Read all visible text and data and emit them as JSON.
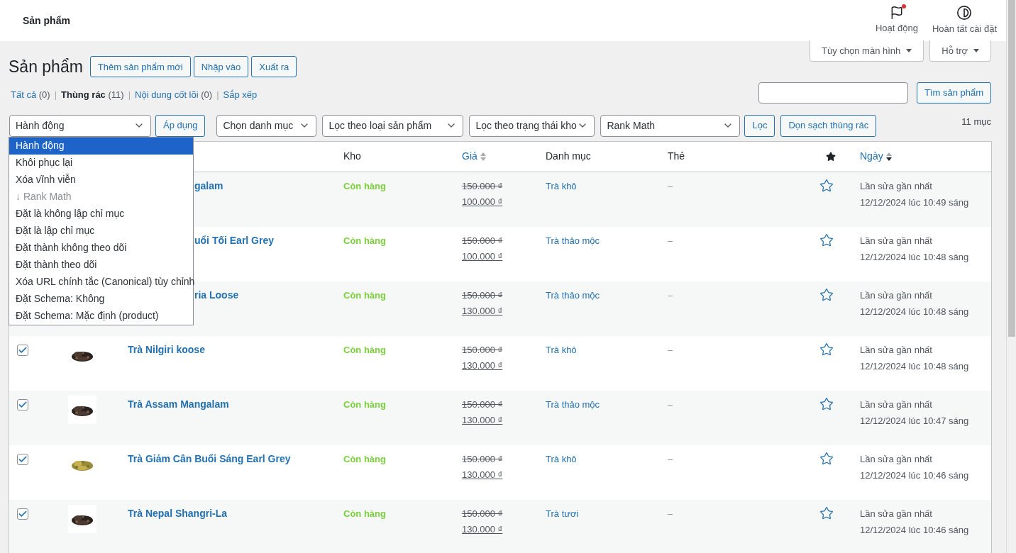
{
  "topbar": {
    "title": "Sản phẩm",
    "actions": [
      {
        "kind": "flag",
        "label": "Hoạt động",
        "badge": true
      },
      {
        "kind": "contrast",
        "label": "Hoàn tất cài đặt",
        "badge": false
      }
    ]
  },
  "screen_tabs": [
    "Tùy chọn màn hình",
    "Hỗ trợ"
  ],
  "heading": "Sản phẩm",
  "heading_buttons": [
    "Thêm sản phẩm mới",
    "Nhập vào",
    "Xuất ra"
  ],
  "views": [
    {
      "label": "Tất cả",
      "count": "(0)",
      "selected": false
    },
    {
      "separator": "|",
      "label": "Thùng rác",
      "count": "(11)",
      "selected": true
    },
    {
      "separator": "|",
      "label": "Nội dung cốt lõi",
      "count": "(0)",
      "selected": false
    },
    {
      "separator": "|",
      "label": "Sắp xếp",
      "selected": false
    }
  ],
  "search": {
    "button": "Tìm sản phẩm"
  },
  "filters": {
    "bulk": "Hành động",
    "apply": "Áp dụng",
    "selects": [
      "Chọn danh mục",
      "Lọc theo loại sản phẩm",
      "Lọc theo trạng thái kho",
      "Rank Math"
    ],
    "filter_button": "Lọc",
    "empty_trash": "Dọn sạch thùng rác",
    "count": "11 mục"
  },
  "bulk_menu": [
    {
      "label": "Hành động",
      "selected": true,
      "disabled": false
    },
    {
      "label": "Khôi phục lại",
      "selected": false,
      "disabled": false
    },
    {
      "label": "Xóa vĩnh viễn",
      "selected": false,
      "disabled": false
    },
    {
      "label": "↓ Rank Math",
      "selected": false,
      "disabled": true
    },
    {
      "label": "Đặt là không lập chỉ mục",
      "selected": false,
      "disabled": false
    },
    {
      "label": "Đặt là lập chỉ mục",
      "selected": false,
      "disabled": false
    },
    {
      "label": "Đặt thành không theo dõi",
      "selected": false,
      "disabled": false
    },
    {
      "label": "Đặt thành theo dõi",
      "selected": false,
      "disabled": false
    },
    {
      "label": "Xóa URL chính tắc (Canonical) tùy chỉnh",
      "selected": false,
      "disabled": false
    },
    {
      "label": "Đặt Schema: Không",
      "selected": false,
      "disabled": false
    },
    {
      "label": "Đặt Schema: Mặc định (product)",
      "selected": false,
      "disabled": false
    }
  ],
  "table": {
    "columns": [
      {
        "kind": "text",
        "label": "Kho"
      },
      {
        "kind": "sort",
        "label": "Giá",
        "sorted": false
      },
      {
        "kind": "text",
        "label": "Danh mục"
      },
      {
        "kind": "text",
        "label": "Thẻ"
      },
      {
        "kind": "icon"
      },
      {
        "kind": "sort",
        "label": "Ngày",
        "sorted": true
      }
    ],
    "rows": [
      {
        "covered": true,
        "name": "galam",
        "stock": "Còn hàng",
        "old_price": "150.000 ₫",
        "price": "100.000 ₫",
        "category": "Trà khô",
        "tags": "–",
        "featured": false,
        "date_label": "Lần sửa gần nhất",
        "date": "12/12/2024 lúc 10:49 sáng"
      },
      {
        "covered": true,
        "name": "uổi Tối Earl Grey",
        "stock": "Còn hàng",
        "old_price": "150.000 ₫",
        "price": "100.000 ₫",
        "category": "Trà thảo mộc",
        "tags": "–",
        "featured": false,
        "date_label": "Lần sửa gần nhất",
        "date": "12/12/2024 lúc 10:48 sáng"
      },
      {
        "covered": true,
        "name": "ria Loose",
        "stock": "Còn hàng",
        "old_price": "150.000 ₫",
        "price": "130.000 ₫",
        "category": "Trà thảo mộc",
        "tags": "–",
        "featured": false,
        "date_label": "Lần sửa gần nhất",
        "date": "12/12/2024 lúc 10:48 sáng"
      },
      {
        "covered": false,
        "checked": true,
        "name": "Trà Nilgiri koose",
        "stock": "Còn hàng",
        "old_price": "150.000 ₫",
        "price": "130.000 ₫",
        "category": "Trà khô",
        "tags": "–",
        "featured": false,
        "date_label": "Lần sửa gần nhất",
        "date": "12/12/2024 lúc 10:48 sáng"
      },
      {
        "covered": false,
        "checked": true,
        "name": "Trà Assam Mangalam",
        "stock": "Còn hàng",
        "old_price": "150.000 ₫",
        "price": "130.000 ₫",
        "category": "Trà thảo mộc",
        "tags": "–",
        "featured": false,
        "date_label": "Lần sửa gần nhất",
        "date": "12/12/2024 lúc 10:47 sáng"
      },
      {
        "covered": false,
        "checked": true,
        "name": "Trà Giảm Cân Buổi Sáng Earl Grey",
        "stock": "Còn hàng",
        "old_price": "150.000 ₫",
        "price": "130.000 ₫",
        "category": "Trà khô",
        "tags": "–",
        "featured": false,
        "date_label": "Lần sửa gần nhất",
        "date": "12/12/2024 lúc 10:46 sáng"
      },
      {
        "covered": false,
        "checked": true,
        "name": "Trà Nepal Shangri-La",
        "stock": "Còn hàng",
        "old_price": "150.000 ₫",
        "price": "130.000 ₫",
        "category": "Trà tươi",
        "tags": "–",
        "featured": false,
        "date_label": "Lần sửa gần nhất",
        "date": "12/12/2024 lúc 10:46 sáng"
      }
    ]
  }
}
